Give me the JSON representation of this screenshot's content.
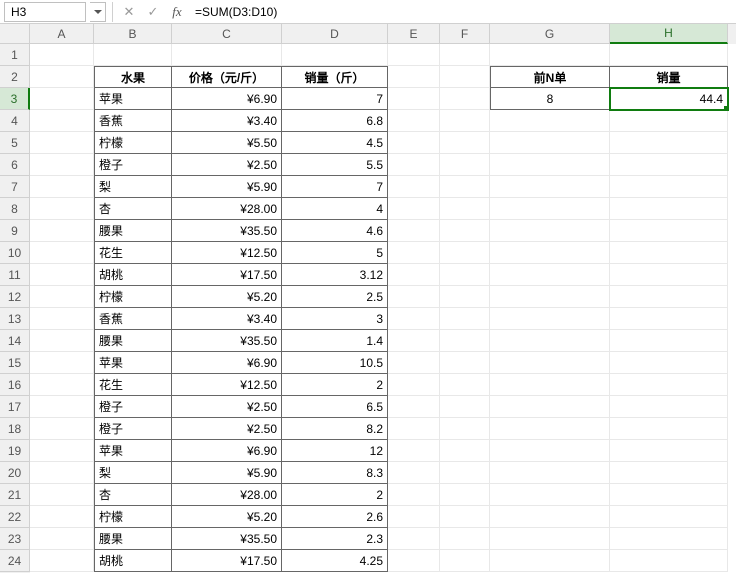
{
  "namebox": "H3",
  "formula": "=SUM(D3:D10)",
  "columns": [
    "A",
    "B",
    "C",
    "D",
    "E",
    "F",
    "G",
    "H"
  ],
  "selected_col": "H",
  "selected_row": 3,
  "row_count": 24,
  "headers": {
    "fruit": "水果",
    "price": "价格（元/斤）",
    "qty": "销量（斤）"
  },
  "summary_headers": {
    "topn": "前N单",
    "qty": "销量"
  },
  "summary": {
    "topn": "8",
    "qty": "44.4"
  },
  "rows": [
    {
      "fruit": "苹果",
      "price": "¥6.90",
      "qty": "7"
    },
    {
      "fruit": "香蕉",
      "price": "¥3.40",
      "qty": "6.8"
    },
    {
      "fruit": "柠檬",
      "price": "¥5.50",
      "qty": "4.5"
    },
    {
      "fruit": "橙子",
      "price": "¥2.50",
      "qty": "5.5"
    },
    {
      "fruit": "梨",
      "price": "¥5.90",
      "qty": "7"
    },
    {
      "fruit": "杏",
      "price": "¥28.00",
      "qty": "4"
    },
    {
      "fruit": "腰果",
      "price": "¥35.50",
      "qty": "4.6"
    },
    {
      "fruit": "花生",
      "price": "¥12.50",
      "qty": "5"
    },
    {
      "fruit": "胡桃",
      "price": "¥17.50",
      "qty": "3.12"
    },
    {
      "fruit": "柠檬",
      "price": "¥5.20",
      "qty": "2.5"
    },
    {
      "fruit": "香蕉",
      "price": "¥3.40",
      "qty": "3"
    },
    {
      "fruit": "腰果",
      "price": "¥35.50",
      "qty": "1.4"
    },
    {
      "fruit": "苹果",
      "price": "¥6.90",
      "qty": "10.5"
    },
    {
      "fruit": "花生",
      "price": "¥12.50",
      "qty": "2"
    },
    {
      "fruit": "橙子",
      "price": "¥2.50",
      "qty": "6.5"
    },
    {
      "fruit": "橙子",
      "price": "¥2.50",
      "qty": "8.2"
    },
    {
      "fruit": "苹果",
      "price": "¥6.90",
      "qty": "12"
    },
    {
      "fruit": "梨",
      "price": "¥5.90",
      "qty": "8.3"
    },
    {
      "fruit": "杏",
      "price": "¥28.00",
      "qty": "2"
    },
    {
      "fruit": "柠檬",
      "price": "¥5.20",
      "qty": "2.6"
    },
    {
      "fruit": "腰果",
      "price": "¥35.50",
      "qty": "2.3"
    },
    {
      "fruit": "胡桃",
      "price": "¥17.50",
      "qty": "4.25"
    }
  ],
  "chart_data": {
    "type": "table",
    "title": "",
    "columns": [
      "水果",
      "价格（元/斤）",
      "销量（斤）"
    ],
    "data": [
      [
        "苹果",
        6.9,
        7
      ],
      [
        "香蕉",
        3.4,
        6.8
      ],
      [
        "柠檬",
        5.5,
        4.5
      ],
      [
        "橙子",
        2.5,
        5.5
      ],
      [
        "梨",
        5.9,
        7
      ],
      [
        "杏",
        28.0,
        4
      ],
      [
        "腰果",
        35.5,
        4.6
      ],
      [
        "花生",
        12.5,
        5
      ],
      [
        "胡桃",
        17.5,
        3.12
      ],
      [
        "柠檬",
        5.2,
        2.5
      ],
      [
        "香蕉",
        3.4,
        3
      ],
      [
        "腰果",
        35.5,
        1.4
      ],
      [
        "苹果",
        6.9,
        10.5
      ],
      [
        "花生",
        12.5,
        2
      ],
      [
        "橙子",
        2.5,
        6.5
      ],
      [
        "橙子",
        2.5,
        8.2
      ],
      [
        "苹果",
        6.9,
        12
      ],
      [
        "梨",
        5.9,
        8.3
      ],
      [
        "杏",
        28.0,
        2
      ],
      [
        "柠檬",
        5.2,
        2.6
      ],
      [
        "腰果",
        35.5,
        2.3
      ],
      [
        "胡桃",
        17.5,
        4.25
      ]
    ],
    "summary": {
      "前N单": 8,
      "销量": 44.4
    }
  }
}
